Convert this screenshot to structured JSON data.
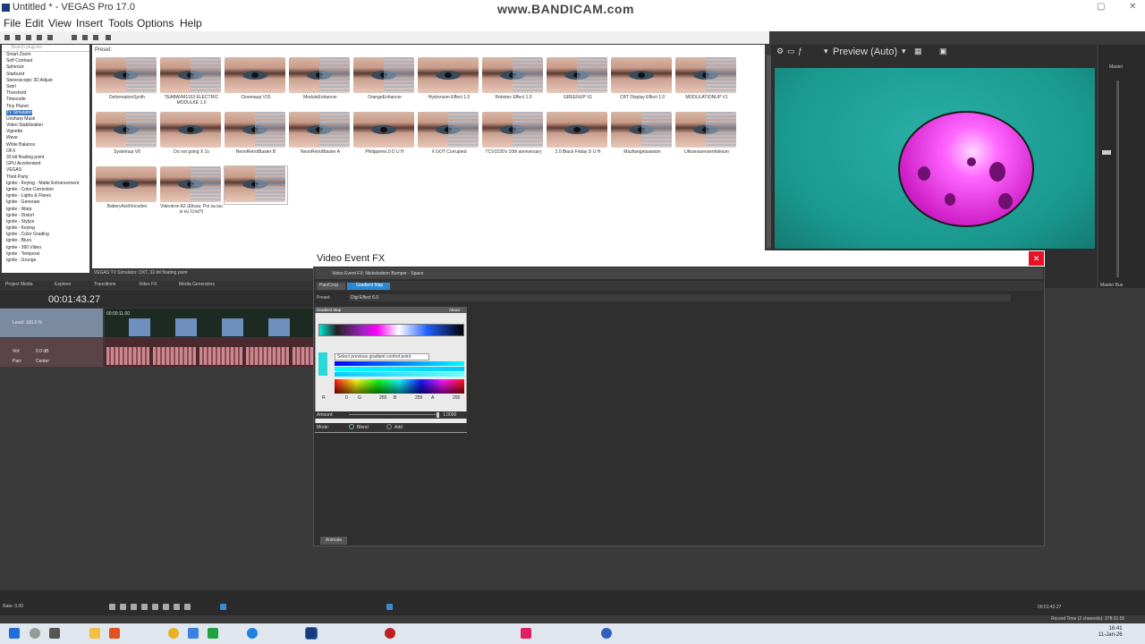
{
  "app": {
    "title": "Untitled * - VEGAS Pro 17.0",
    "watermark": "www.BANDICAM.com"
  },
  "menu": [
    "File",
    "Edit",
    "View",
    "Insert",
    "Tools",
    "Options",
    "Help"
  ],
  "tree": {
    "search_placeholder": "Search plug-ins",
    "items": [
      "Smart Zoom",
      "Soft Contrast",
      "Spherize",
      "Starburst",
      "Stereoscopic 3D Adjust",
      "Swirl",
      "Threshold",
      "Timecode",
      "Tiny Planet",
      "TV Simulator",
      "Unsharp Mask",
      "Video Stabilization",
      "Vignette",
      "Wave",
      "White Balance",
      "OFX",
      "32-bit floating point",
      "GPU Accelerated",
      "VEGAS",
      "Third Party",
      "Ignite - Keying - Matte Enhancement",
      "Ignite - Color Correction",
      "Ignite - Lights & Flares",
      "Ignite - Generate",
      "Ignite - Warp",
      "Ignite - Distort",
      "Ignite - Stylize",
      "Ignite - Keying",
      "Ignite - Color Grading",
      "Ignite - Blurs",
      "Ignite - 360 Video",
      "Ignite - Temporal",
      "Ignite - Grunge"
    ],
    "selected": "TV Simulator"
  },
  "presets": {
    "label": "Preset:",
    "items": [
      "DeformationSynth",
      "TEABAVM1153 ELECTRIC MODULKE 1.0",
      "Cinemaup V15",
      "ModuleEnhancer",
      "OrangeEnhancer",
      "Hydronium Effect 1.0",
      "Robotec Effect 1.0",
      "GREENUP V1",
      "CRT Display Effect 1.0",
      "MODULATIONUP V1",
      "Systemup V8",
      "Do not going X 1s",
      "NeonRetroBlaster B",
      "NeonRetroBlaster A",
      "Philippines.0 D U H",
      "X GOT Corrupted",
      "TCV1530's 10th anniversary",
      "2.0 Black Friday D U H",
      "Mazfiangetsawium",
      "Ultramaxensembleium",
      "BatteryAcidVocodex",
      "Videotron A2 (Elissa: Poi sa iau si eu Crist?)",
      ""
    ]
  },
  "status_line": "VEGAS TV Simulator: DXT, 32-bit floating point",
  "preview": {
    "label": "Preview (Auto)"
  },
  "mixer": {
    "master": "Master",
    "master_bus": "Master Bus"
  },
  "tabs": [
    "Project Media",
    "Explorer",
    "Transitions",
    "Video FX",
    "Media Generators"
  ],
  "timeline": {
    "timecode": "00:01:43.27",
    "track1_level": "Level: 100.0 %",
    "track2_vol_label": "Vol:",
    "track2_vol": "0.0 dB",
    "track2_pan_label": "Pan:",
    "track2_pan": "Center",
    "clip_label": "00:00:11.00"
  },
  "dialog": {
    "title": "Video Event FX",
    "subtitle": "Video Event FX: Nickelodeon Bumper - Space",
    "chain_pan": "Pan/Crop",
    "chain_gm": "Gradient Map",
    "preset_label": "Preset:",
    "preset_value": "Digi Effect 6.0",
    "plugin_title": "Gradient Map",
    "plugin_about": "About",
    "tooltip": "Select previous gradient control point",
    "r_label": "R",
    "r_val": "0",
    "g_label": "G",
    "g_val": "255",
    "b_label": "B",
    "b_val": "255",
    "a_label": "A",
    "a_val": "255",
    "amount_label": "Amount:",
    "amount_val": "1.0000",
    "mode_label": "Mode:",
    "mode_blend": "Blend",
    "mode_add": "Add",
    "animate": "Animate"
  },
  "transport": {
    "rate": "Rate: 0.00",
    "record_time": "Record Time (2 channels): 378:31:55",
    "end_time": "00:01:43.27"
  },
  "clock": {
    "time": "16:41",
    "date": "11-Jan-26"
  }
}
